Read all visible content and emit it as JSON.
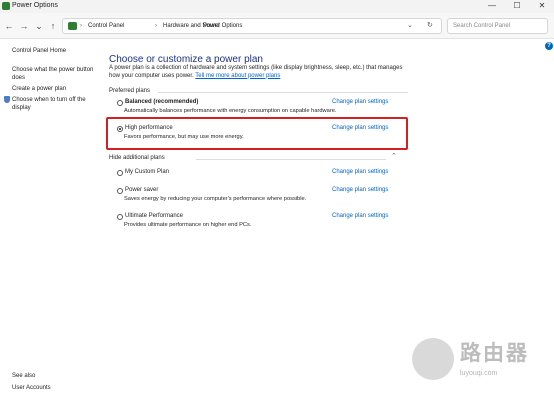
{
  "window": {
    "title": "Power Options",
    "controls": {
      "minimize": "—",
      "maximize": "☐",
      "close": "✕"
    }
  },
  "nav": {
    "back": "←",
    "forward": "→",
    "dropdown": "⌄",
    "up": "↑",
    "breadcrumb": [
      "Control Panel",
      "Hardware and Sound",
      "Power Options"
    ],
    "breadcrumb_separator": "›",
    "address_dropdown": "⌄",
    "refresh": "↻",
    "search_placeholder": "Search Control Panel"
  },
  "help": {
    "label": "?"
  },
  "sidebar": {
    "items": [
      {
        "label": "Control Panel Home"
      },
      {
        "label": "Choose what the power button does"
      },
      {
        "label": "Create a power plan"
      },
      {
        "label": "Choose when to turn off the display"
      }
    ],
    "see_also": "See also",
    "user_accounts": "User Accounts"
  },
  "main": {
    "title": "Choose or customize a power plan",
    "intro": "A power plan is a collection of hardware and system settings (like display brightness, sleep, etc.) that manages how your computer uses power.",
    "intro_link": "Tell me more about power plans",
    "preferred_label": "Preferred plans",
    "hide_label": "Hide additional plans",
    "change_link": "Change plan settings",
    "preferred_plans": [
      {
        "name": "Balanced (recommended)",
        "desc": "Automatically balances performance with energy consumption on capable hardware.",
        "selected": false
      },
      {
        "name": "High performance",
        "desc": "Favors performance, but may use more energy.",
        "selected": true
      }
    ],
    "additional_plans": [
      {
        "name": "My Custom Plan",
        "desc": "",
        "selected": false
      },
      {
        "name": "Power saver",
        "desc": "Saves energy by reducing your computer's performance where possible.",
        "selected": false
      },
      {
        "name": "Ultimate Performance",
        "desc": "Provides ultimate performance on higher end PCs.",
        "selected": false
      }
    ]
  },
  "watermark": {
    "brand": "路由器",
    "url": "luyouqi.com"
  },
  "colors": {
    "title_blue": "#1e3287",
    "link_blue": "#0066cc",
    "highlight_red": "#d32121"
  }
}
